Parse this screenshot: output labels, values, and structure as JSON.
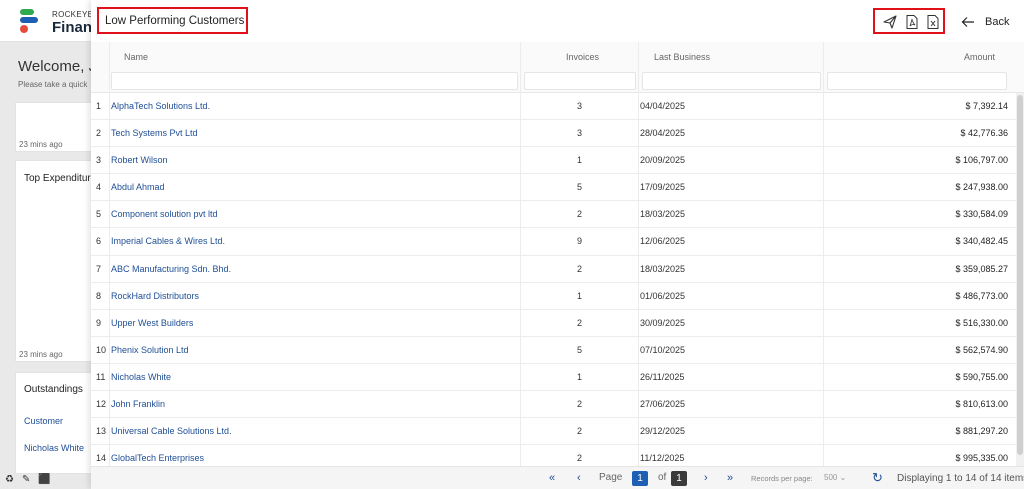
{
  "background": {
    "brand_top": "ROCKEYE",
    "brand_main": "Financ",
    "welcome": "Welcome, Je",
    "welcome_sub": "Please take a quick",
    "time_1": "23 mins ago",
    "card_title_1": "Top Expenditur",
    "time_2": "23 mins ago",
    "card_title_2": "Outstandings",
    "link_customer": "Customer",
    "link_nicholas": "Nicholas White"
  },
  "modal": {
    "title": "Low Performing Customers",
    "actions": {
      "send_icon": "paper-plane-icon",
      "pdf_icon": "pdf-file-icon",
      "excel_icon": "excel-file-icon"
    },
    "back_label": "Back"
  },
  "table": {
    "columns": {
      "name": "Name",
      "invoices": "Invoices",
      "last_business": "Last Business",
      "amount": "Amount"
    },
    "rows": [
      {
        "idx": "1",
        "name": "AlphaTech Solutions Ltd.",
        "invoices": "3",
        "last_business": "04/04/2025",
        "amount": "$ 7,392.14"
      },
      {
        "idx": "2",
        "name": "Tech Systems Pvt Ltd",
        "invoices": "3",
        "last_business": "28/04/2025",
        "amount": "$ 42,776.36"
      },
      {
        "idx": "3",
        "name": "Robert Wilson",
        "invoices": "1",
        "last_business": "20/09/2025",
        "amount": "$ 106,797.00"
      },
      {
        "idx": "4",
        "name": "Abdul Ahmad",
        "invoices": "5",
        "last_business": "17/09/2025",
        "amount": "$ 247,938.00"
      },
      {
        "idx": "5",
        "name": "Component solution pvt ltd",
        "invoices": "2",
        "last_business": "18/03/2025",
        "amount": "$ 330,584.09"
      },
      {
        "idx": "6",
        "name": "Imperial Cables & Wires Ltd.",
        "invoices": "9",
        "last_business": "12/06/2025",
        "amount": "$ 340,482.45"
      },
      {
        "idx": "7",
        "name": "ABC Manufacturing Sdn. Bhd.",
        "invoices": "2",
        "last_business": "18/03/2025",
        "amount": "$ 359,085.27"
      },
      {
        "idx": "8",
        "name": "RockHard Distributors",
        "invoices": "1",
        "last_business": "01/06/2025",
        "amount": "$ 486,773.00"
      },
      {
        "idx": "9",
        "name": "Upper West Builders",
        "invoices": "2",
        "last_business": "30/09/2025",
        "amount": "$ 516,330.00"
      },
      {
        "idx": "10",
        "name": "Phenix Solution Ltd",
        "invoices": "5",
        "last_business": "07/10/2025",
        "amount": "$ 562,574.90"
      },
      {
        "idx": "11",
        "name": "Nicholas White",
        "invoices": "1",
        "last_business": "26/11/2025",
        "amount": "$ 590,755.00"
      },
      {
        "idx": "12",
        "name": "John Franklin",
        "invoices": "2",
        "last_business": "27/06/2025",
        "amount": "$ 810,613.00"
      },
      {
        "idx": "13",
        "name": "Universal Cable Solutions Ltd.",
        "invoices": "2",
        "last_business": "29/12/2025",
        "amount": "$ 881,297.20"
      },
      {
        "idx": "14",
        "name": "GlobalTech Enterprises",
        "invoices": "2",
        "last_business": "11/12/2025",
        "amount": "$ 995,335.00"
      }
    ]
  },
  "pagination": {
    "page_label": "Page",
    "current_page": "1",
    "of_label": "of",
    "total_pages": "1",
    "rpp_label": "Records per page:",
    "rpp_value": "500",
    "displaying": "Displaying 1 to 14 of 14 items."
  },
  "colors": {
    "accent": "#1e5eb3",
    "link": "#1f4e96",
    "highlight": "#e0111b"
  }
}
